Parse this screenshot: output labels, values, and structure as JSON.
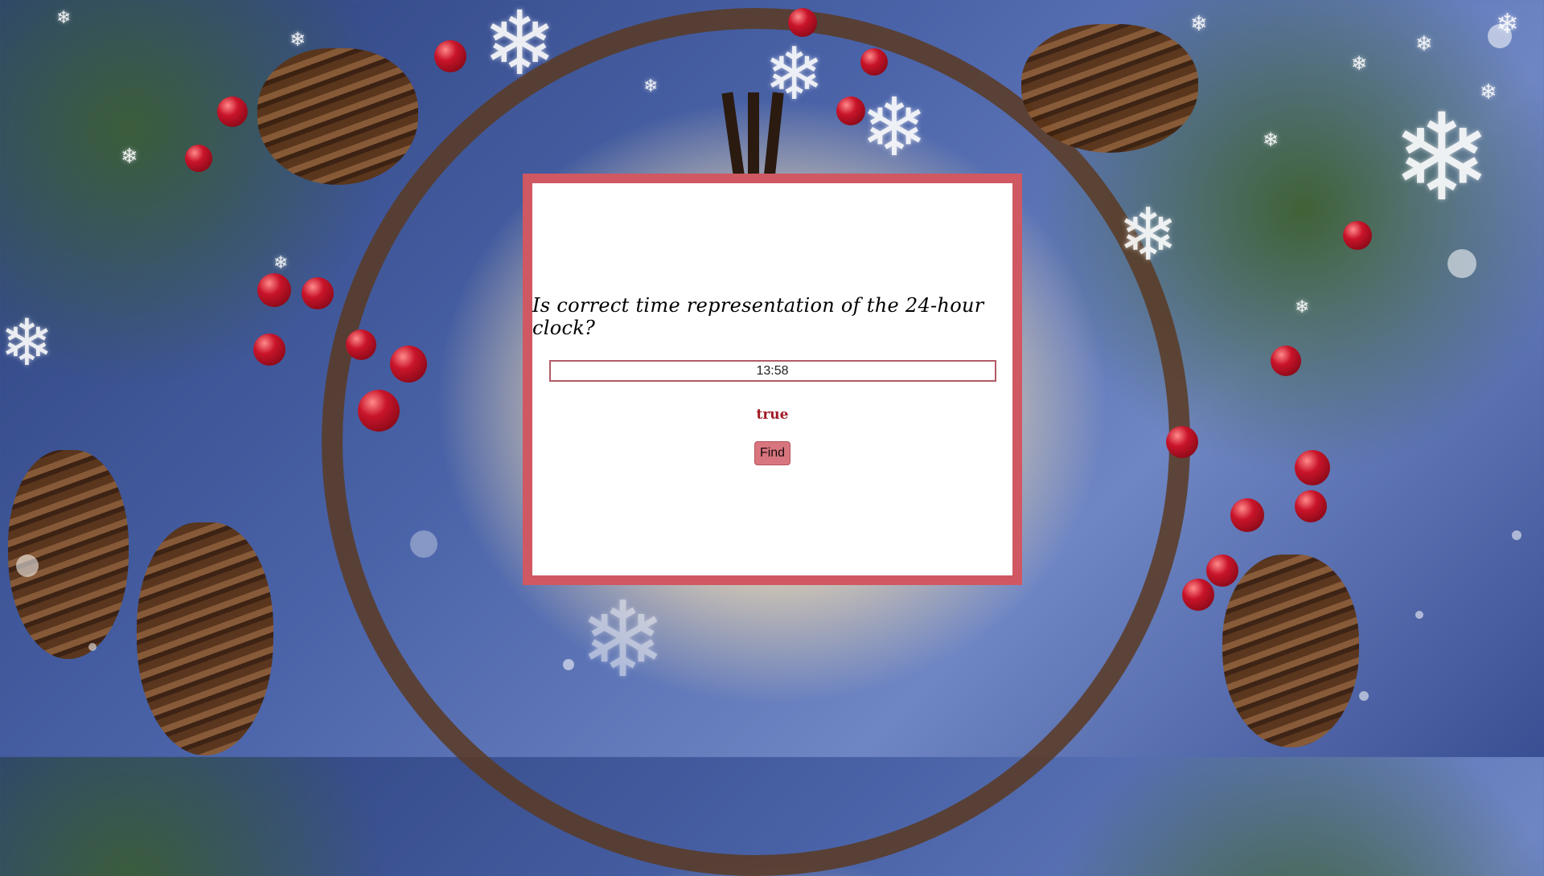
{
  "quiz": {
    "question": "Is correct time representation of the 24-hour clock?",
    "input_value": "13:58",
    "result": "true",
    "find_label": "Find"
  },
  "colors": {
    "frame": "#cf5862",
    "panel": "#ffffff",
    "result_text": "#a01a26",
    "button": "#d8757e"
  },
  "background": {
    "icons": [
      "clock-face",
      "pine-branches",
      "red-berries",
      "pine-cones",
      "snowflakes"
    ]
  }
}
